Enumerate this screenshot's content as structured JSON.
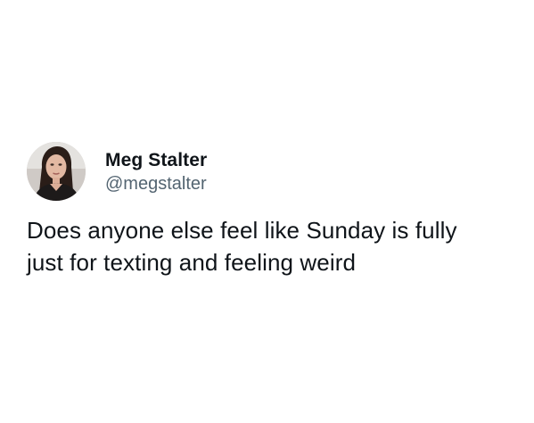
{
  "tweet": {
    "author": {
      "display_name": "Meg Stalter",
      "handle": "@megstalter",
      "avatar_icon": "profile-photo"
    },
    "text": "Does anyone else feel like Sunday is fully\njust for texting and feeling weird"
  },
  "colors": {
    "background": "#ffffff",
    "text_primary": "#0f1419",
    "text_secondary": "#536471"
  }
}
